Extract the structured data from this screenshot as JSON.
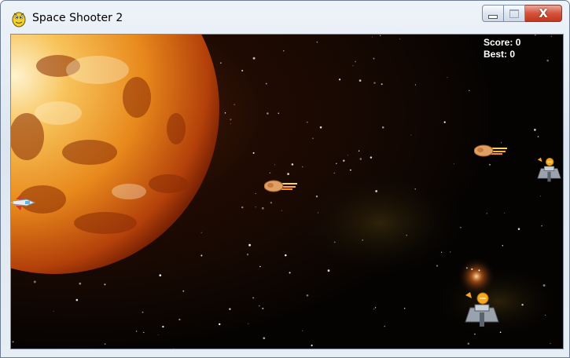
{
  "window": {
    "title": "Space Shooter 2",
    "icon": "pygame-snake-icon",
    "buttons": {
      "minimize": "minimize-icon",
      "maximize": "maximize-icon",
      "close": "close-icon",
      "close_glyph": "X"
    }
  },
  "hud": {
    "score_label": "Score:",
    "score_value": "0",
    "best_label": "Best:",
    "best_value": "0"
  },
  "scene": {
    "background": "starfield",
    "sun_color": "#e8891c",
    "player": "player-ship",
    "meteors": [
      "meteor",
      "meteor"
    ],
    "enemies": [
      "enemy-ship",
      "enemy-ship"
    ]
  },
  "colors": {
    "hud_text": "#ffffff",
    "space": "#050302",
    "sun_core": "#f7c35a",
    "sun_edge": "#b3400a"
  }
}
